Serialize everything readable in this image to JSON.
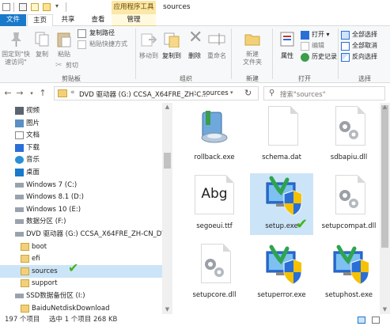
{
  "window": {
    "title": "sources",
    "context_tab": "应用程序工具"
  },
  "ribbon_tabs": {
    "file": "文件",
    "home": "主页",
    "share": "共享",
    "view": "查看",
    "manage": "管理"
  },
  "ribbon": {
    "clipboard": {
      "pin_label": "固定到\"快速访问\"",
      "copy_label": "复制",
      "paste_label": "粘贴",
      "cut_label": "剪切",
      "copy_path_label": "复制路径",
      "paste_shortcut_label": "粘贴快捷方式",
      "group_label": "剪贴板"
    },
    "organize": {
      "move_to_label": "移动到",
      "copy_to_label": "复制到",
      "delete_label": "删除",
      "rename_label": "重命名",
      "group_label": "组织"
    },
    "new": {
      "new_folder_label": "新建\n文件夹",
      "group_label": "新建"
    },
    "open": {
      "properties_label": "属性",
      "open_label": "打开 ▾",
      "edit_label": "编辑",
      "history_label": "历史记录",
      "group_label": "打开"
    },
    "select": {
      "select_all_label": "全部选择",
      "select_none_label": "全部取消",
      "invert_label": "反向选择",
      "group_label": "选择"
    }
  },
  "address": {
    "prefix": "«",
    "crumbs": [
      "DVD 驱动器 (G:) CCSA_X64FRE_ZH-C...",
      "sources"
    ],
    "separator": "›",
    "search_placeholder": "搜索\"sources\""
  },
  "nav": {
    "items": [
      {
        "label": "视频",
        "icon": "video-library-icon",
        "indent": 1
      },
      {
        "label": "图片",
        "icon": "pictures-library-icon",
        "indent": 1
      },
      {
        "label": "文档",
        "icon": "documents-library-icon",
        "indent": 1
      },
      {
        "label": "下载",
        "icon": "downloads-icon",
        "indent": 1
      },
      {
        "label": "音乐",
        "icon": "music-library-icon",
        "indent": 1
      },
      {
        "label": "桌面",
        "icon": "desktop-icon",
        "indent": 1
      },
      {
        "label": "Windows 7 (C:)",
        "icon": "drive-icon",
        "indent": 1
      },
      {
        "label": "Windows 8.1 (D:)",
        "icon": "drive-icon",
        "indent": 1
      },
      {
        "label": "Windows 10 (E:)",
        "icon": "drive-icon",
        "indent": 1
      },
      {
        "label": "数据分区 (F:)",
        "icon": "drive-icon",
        "indent": 1
      },
      {
        "label": "DVD 驱动器 (G:) CCSA_X64FRE_ZH-CN_DV5",
        "icon": "dvd-drive-icon",
        "indent": 1
      },
      {
        "label": "boot",
        "icon": "folder-icon",
        "indent": 2
      },
      {
        "label": "efi",
        "icon": "folder-icon",
        "indent": 2
      },
      {
        "label": "sources",
        "icon": "folder-icon",
        "indent": 2,
        "selected": true
      },
      {
        "label": "support",
        "icon": "folder-icon",
        "indent": 2
      },
      {
        "label": "SSD数据备份区 (I:)",
        "icon": "drive-icon",
        "indent": 1
      },
      {
        "label": "BaiduNetdiskDownload",
        "icon": "folder-icon",
        "indent": 2
      }
    ]
  },
  "files": [
    {
      "name": "rollback.exe",
      "icon": "rollback-app-icon"
    },
    {
      "name": "schema.dat",
      "icon": "generic-document-icon"
    },
    {
      "name": "sdbapiu.dll",
      "icon": "dll-gear-icon"
    },
    {
      "name": "segoeui.ttf",
      "icon": "font-file-icon",
      "font_sample": "Abg"
    },
    {
      "name": "setup.exe",
      "icon": "setup-installer-icon",
      "selected": true
    },
    {
      "name": "setupcompat.dll",
      "icon": "dll-gear-icon"
    },
    {
      "name": "setupcore.dll",
      "icon": "dll-gear-icon"
    },
    {
      "name": "setuperror.exe",
      "icon": "setup-installer-icon"
    },
    {
      "name": "setuphost.exe",
      "icon": "setup-installer-icon"
    }
  ],
  "status": {
    "item_count": "197 个项目",
    "selection": "选中 1 个项目  268 KB"
  },
  "colors": {
    "accent": "#1979ca",
    "selection": "#cce4f7",
    "context_tab": "#fbe7a6",
    "checkmark": "#3fb618",
    "shield_blue": "#2a6fd6",
    "shield_yellow": "#f6c100"
  }
}
